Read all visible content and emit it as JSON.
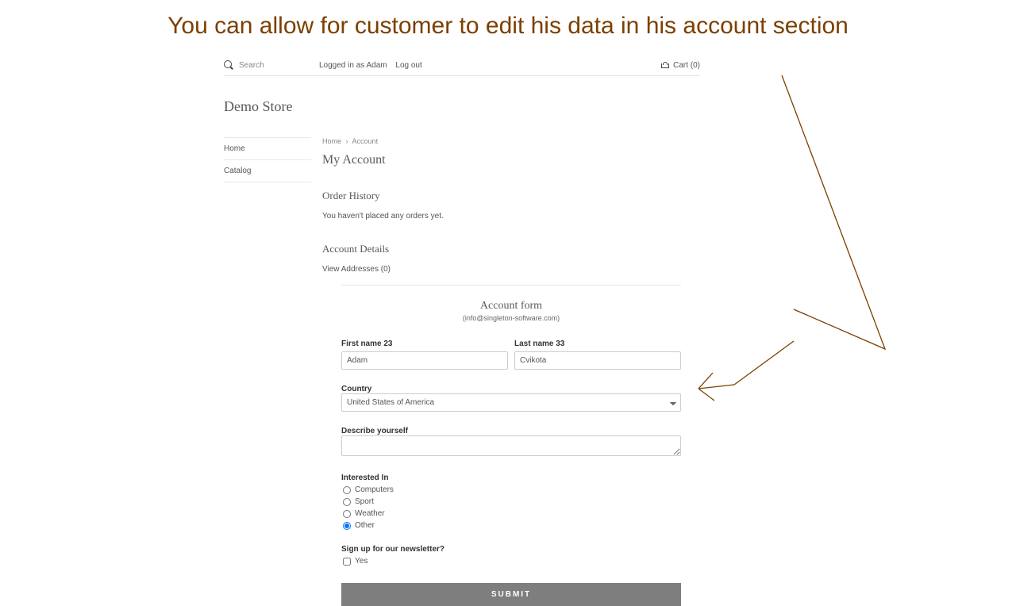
{
  "headline": "You can allow for customer to edit his data in his account section",
  "topbar": {
    "search_placeholder": "Search",
    "logged_in_as": "Logged in as Adam",
    "logout": "Log out",
    "cart_label": "Cart (0)"
  },
  "store_name": "Demo Store",
  "sidebar": {
    "items": [
      {
        "label": "Home"
      },
      {
        "label": "Catalog"
      }
    ]
  },
  "breadcrumbs": {
    "home": "Home",
    "current": "Account"
  },
  "account": {
    "title": "My Account",
    "order_history_heading": "Order History",
    "no_orders": "You haven't placed any orders yet.",
    "details_heading": "Account Details",
    "view_addresses": "View Addresses (0)"
  },
  "form": {
    "title": "Account form",
    "subtitle": "(info@singleton-software.com)",
    "first_name_label": "First name 23",
    "first_name_value": "Adam",
    "last_name_label": "Last name 33",
    "last_name_value": "Cvikota",
    "country_label": "Country",
    "country_value": "United States of America",
    "describe_label": "Describe yourself",
    "describe_value": "",
    "interested_label": "Interested In",
    "interests": [
      {
        "label": "Computers",
        "checked": false
      },
      {
        "label": "Sport",
        "checked": false
      },
      {
        "label": "Weather",
        "checked": false
      },
      {
        "label": "Other",
        "checked": true
      }
    ],
    "newsletter_label": "Sign up for our newsletter?",
    "newsletter_option": "Yes",
    "submit": "SUBMIT"
  }
}
